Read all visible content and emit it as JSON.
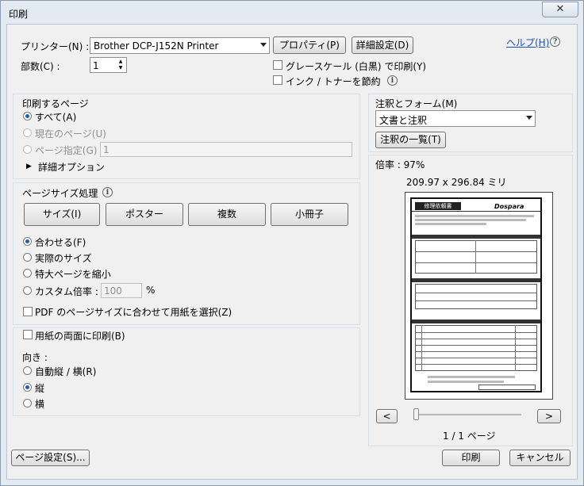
{
  "window": {
    "title": "印刷",
    "close_glyph": "✕"
  },
  "printer": {
    "label": "プリンター(N) :",
    "selected": "Brother DCP-J152N Printer",
    "properties_button": "プロパティ(P)",
    "advanced_button": "詳細設定(D)",
    "help_link": "ヘルプ(H)",
    "help_icon": "?"
  },
  "copies": {
    "label": "部数(C) :",
    "value": "1"
  },
  "options": {
    "grayscale": {
      "label": "グレースケール (白黒) で印刷(Y)",
      "checked": false
    },
    "save_ink": {
      "label": "インク / トナーを節約",
      "checked": false
    },
    "info_icon": "i"
  },
  "pages_to_print": {
    "heading": "印刷するページ",
    "all": "すべて(A)",
    "current": "現在のページ(U)",
    "range": "ページ指定(G)",
    "range_value": "1",
    "more_options": "詳細オプション",
    "selected": "all"
  },
  "page_sizing": {
    "heading": "ページサイズ処理",
    "buttons": [
      "サイズ(I)",
      "ポスター",
      "複数",
      "小冊子"
    ],
    "fit": "合わせる(F)",
    "actual": "実際のサイズ",
    "shrink": "特大ページを縮小",
    "custom": "カスタム倍率 :",
    "custom_value": "100",
    "percent": "%",
    "pdf_paper": "PDF のページサイズに合わせて用紙を選択(Z)",
    "selected": "fit"
  },
  "duplex": {
    "label": "用紙の両面に印刷(B)",
    "checked": false
  },
  "orientation": {
    "heading": "向き :",
    "auto": "自動縦 / 横(R)",
    "portrait": "縦",
    "landscape": "横",
    "selected": "portrait"
  },
  "comments_forms": {
    "heading": "注釈とフォーム(M)",
    "selected": "文書と注釈",
    "summary_button": "注釈の一覧(T)"
  },
  "preview": {
    "scale": "倍率 : 97%",
    "dimensions": "209.97 x 296.84 ミリ",
    "prev": "<",
    "next": ">",
    "page_counter": "1 / 1 ページ",
    "page_position_fraction": 0.0
  },
  "footer": {
    "page_setup": "ページ設定(S)...",
    "print": "印刷",
    "cancel": "キャンセル"
  },
  "thumbnail": {
    "doc_title": "修理依頼書",
    "brand": "Dospara"
  },
  "colors": {
    "link": "#1a4dbd",
    "radio_dot": "#1d5fa8",
    "window_frame": "#e3eaf2"
  }
}
